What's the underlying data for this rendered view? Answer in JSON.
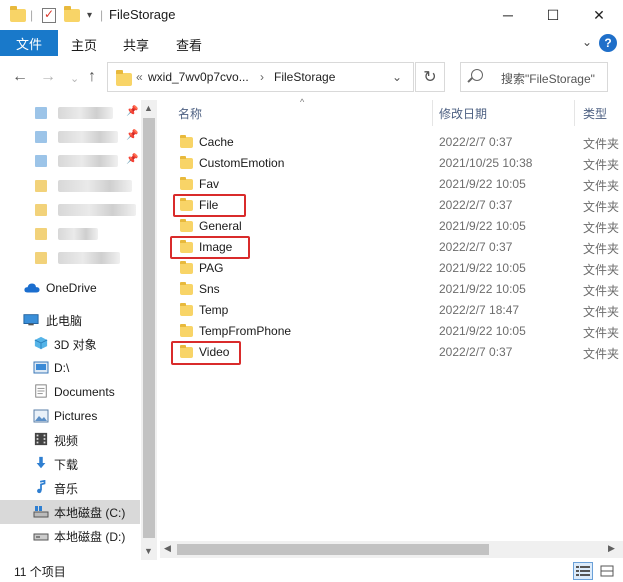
{
  "window": {
    "title": "FileStorage",
    "controls": {
      "minimize": "─",
      "maximize": "☐",
      "close": "✕"
    }
  },
  "ribbon": {
    "file_tab": "文件",
    "tabs": [
      "主页",
      "共享",
      "查看"
    ],
    "expand_glyph": "⌄",
    "help_glyph": "?"
  },
  "address": {
    "back": "←",
    "forward": "→",
    "recent": "⌄",
    "up": "↑",
    "overflow": "«",
    "crumb1": "wxid_7wv0p7cvo...",
    "crumb_sep": "›",
    "crumb2": "FileStorage",
    "dropdown": "⌄",
    "refresh": "↻",
    "search_placeholder": "搜索\"FileStorage\""
  },
  "nav": {
    "onedrive": "OneDrive",
    "this_pc": "此电脑",
    "items": [
      {
        "label": "3D 对象",
        "icon": "3d-objects-icon"
      },
      {
        "label": "D:\\",
        "icon": "drive-icon"
      },
      {
        "label": "Documents",
        "icon": "documents-icon"
      },
      {
        "label": "Pictures",
        "icon": "pictures-icon"
      },
      {
        "label": "视频",
        "icon": "video-icon"
      },
      {
        "label": "下载",
        "icon": "download-icon"
      },
      {
        "label": "音乐",
        "icon": "music-icon"
      },
      {
        "label": "本地磁盘 (C:)",
        "icon": "local-disk-icon",
        "selected": true
      },
      {
        "label": "本地磁盘 (D:)",
        "icon": "local-disk-icon"
      }
    ]
  },
  "columns": {
    "name": "名称",
    "modified": "修改日期",
    "type": "类型"
  },
  "files": [
    {
      "name": "Cache",
      "modified": "2022/2/7 0:37",
      "type": "文件夹",
      "highlighted": false
    },
    {
      "name": "CustomEmotion",
      "modified": "2021/10/25 10:38",
      "type": "文件夹",
      "highlighted": false
    },
    {
      "name": "Fav",
      "modified": "2021/9/22 10:05",
      "type": "文件夹",
      "highlighted": false
    },
    {
      "name": "File",
      "modified": "2022/2/7 0:37",
      "type": "文件夹",
      "highlighted": true
    },
    {
      "name": "General",
      "modified": "2021/9/22 10:05",
      "type": "文件夹",
      "highlighted": false
    },
    {
      "name": "Image",
      "modified": "2022/2/7 0:37",
      "type": "文件夹",
      "highlighted": true
    },
    {
      "name": "PAG",
      "modified": "2021/9/22 10:05",
      "type": "文件夹",
      "highlighted": false
    },
    {
      "name": "Sns",
      "modified": "2021/9/22 10:05",
      "type": "文件夹",
      "highlighted": false
    },
    {
      "name": "Temp",
      "modified": "2022/2/7 18:47",
      "type": "文件夹",
      "highlighted": false
    },
    {
      "name": "TempFromPhone",
      "modified": "2021/9/22 10:05",
      "type": "文件夹",
      "highlighted": false
    },
    {
      "name": "Video",
      "modified": "2022/2/7 0:37",
      "type": "文件夹",
      "highlighted": true
    }
  ],
  "status": {
    "count_text": "11 个项目"
  },
  "colors": {
    "accent": "#1979ca",
    "highlight_box": "#d92b2b",
    "folder": "#f8d467"
  }
}
